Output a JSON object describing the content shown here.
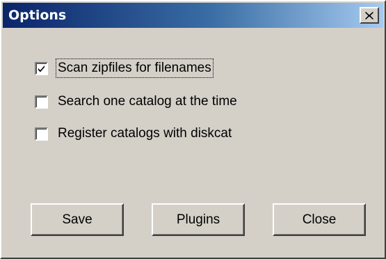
{
  "window": {
    "title": "Options",
    "close_glyph": "✕"
  },
  "options": [
    {
      "label": "Scan zipfiles for filenames",
      "checked": true
    },
    {
      "label": "Search one catalog at the time",
      "checked": false
    },
    {
      "label": "Register catalogs with diskcat",
      "checked": false
    }
  ],
  "buttons": {
    "save": "Save",
    "plugins": "Plugins",
    "close": "Close"
  },
  "icons": {
    "close": "close-icon",
    "check": "checkmark-icon"
  },
  "colors": {
    "titlebar_start": "#0a246a",
    "titlebar_end": "#a6caf0",
    "face": "#d4d0c8"
  }
}
